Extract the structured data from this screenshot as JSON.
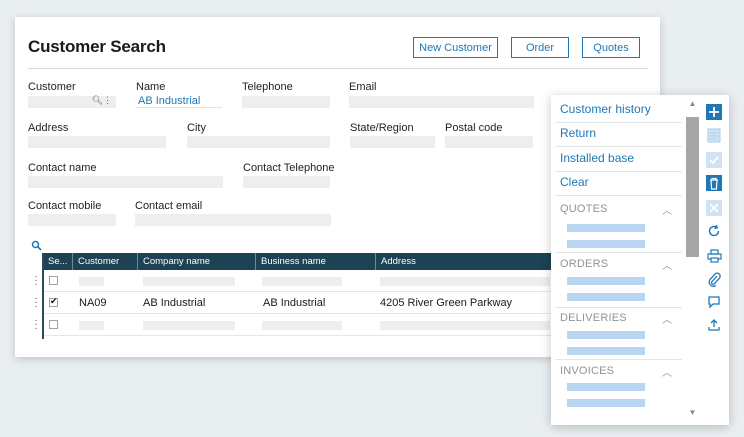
{
  "header": {
    "title": "Customer Search",
    "buttons": [
      "New Customer",
      "Order",
      "Quotes"
    ]
  },
  "form": {
    "customer_label": "Customer",
    "name_label": "Name",
    "name_value": "AB Industrial",
    "telephone_label": "Telephone",
    "email_label": "Email",
    "address_label": "Address",
    "city_label": "City",
    "state_label": "State/Region",
    "postal_label": "Postal code",
    "contact_name_label": "Contact name",
    "contact_telephone_label": "Contact Telephone",
    "contact_mobile_label": "Contact mobile",
    "contact_email_label": "Contact email"
  },
  "grid": {
    "columns": [
      "Se...",
      "Customer",
      "Company name",
      "Business name",
      "Address"
    ],
    "rows": [
      {
        "selected": false,
        "customer": "",
        "company": "",
        "business": "",
        "address": ""
      },
      {
        "selected": true,
        "customer": "NA09",
        "company": "AB Industrial",
        "business": "AB Industrial",
        "address": "4205 River Green Parkway"
      },
      {
        "selected": false,
        "customer": "",
        "company": "",
        "business": "",
        "address": ""
      }
    ]
  },
  "side_panel": {
    "links": [
      "Customer history",
      "Return",
      "Installed base",
      "Clear"
    ],
    "sections": [
      "QUOTES",
      "ORDERS",
      "DELIVERIES",
      "INVOICES"
    ]
  },
  "toolbar_icons": [
    "plus-icon",
    "document-icon",
    "check-icon",
    "trash-icon",
    "close-icon",
    "refresh-icon",
    "print-icon",
    "paperclip-icon",
    "comment-icon",
    "upload-icon"
  ],
  "colors": {
    "accent": "#1f78b4",
    "grid_header": "#1d4253",
    "placeholder_bar": "#b8d6ef"
  }
}
